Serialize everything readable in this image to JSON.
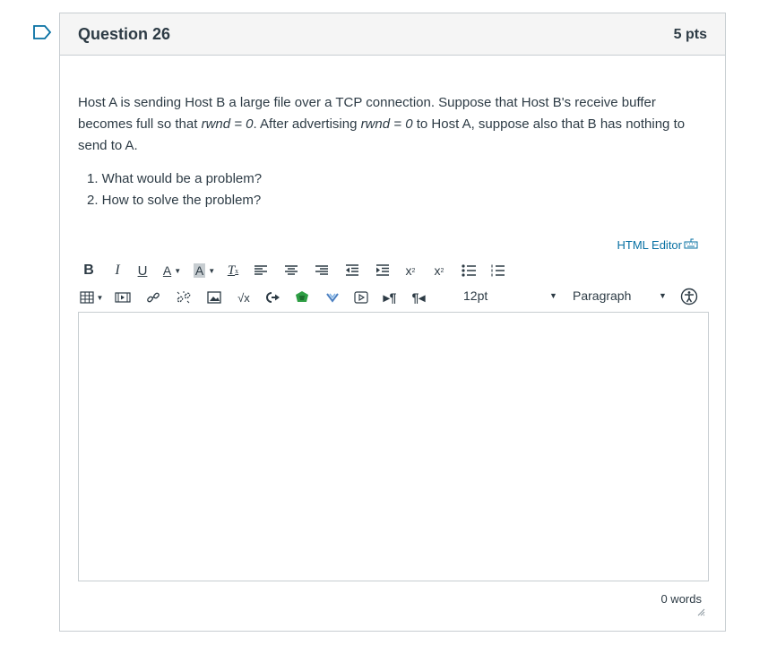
{
  "question": {
    "title": "Question 26",
    "points": "5 pts",
    "text_parts": {
      "a": "Host A is sending Host B a large file over a TCP connection. Suppose that Host B's receive buffer becomes full so that ",
      "b": "rwnd = 0",
      "c": ". After advertising ",
      "d": "rwnd = 0",
      "e": " to Host A, suppose also that B has nothing to send to A."
    },
    "items": [
      "1. What would be a problem?",
      "2. How to solve the problem?"
    ]
  },
  "editor": {
    "html_editor_label": "HTML Editor",
    "font_size": "12pt",
    "paragraph": "Paragraph",
    "word_count": "0 words",
    "toolbar_icons": [
      "bold-icon",
      "italic-icon",
      "underline-icon",
      "text-color-icon",
      "background-color-icon",
      "clear-formatting-icon",
      "align-left-icon",
      "align-center-icon",
      "align-right-icon",
      "outdent-icon",
      "indent-icon",
      "superscript-icon",
      "subscript-icon",
      "bullet-list-icon",
      "numbered-list-icon",
      "table-icon",
      "media-icon",
      "link-icon",
      "unlink-icon",
      "image-icon",
      "math-icon",
      "embed-icon",
      "apps-icon",
      "chevron-icon",
      "record-icon",
      "ltr-icon",
      "rtl-icon",
      "accessibility-icon"
    ],
    "accent_color": "#0770a3"
  }
}
